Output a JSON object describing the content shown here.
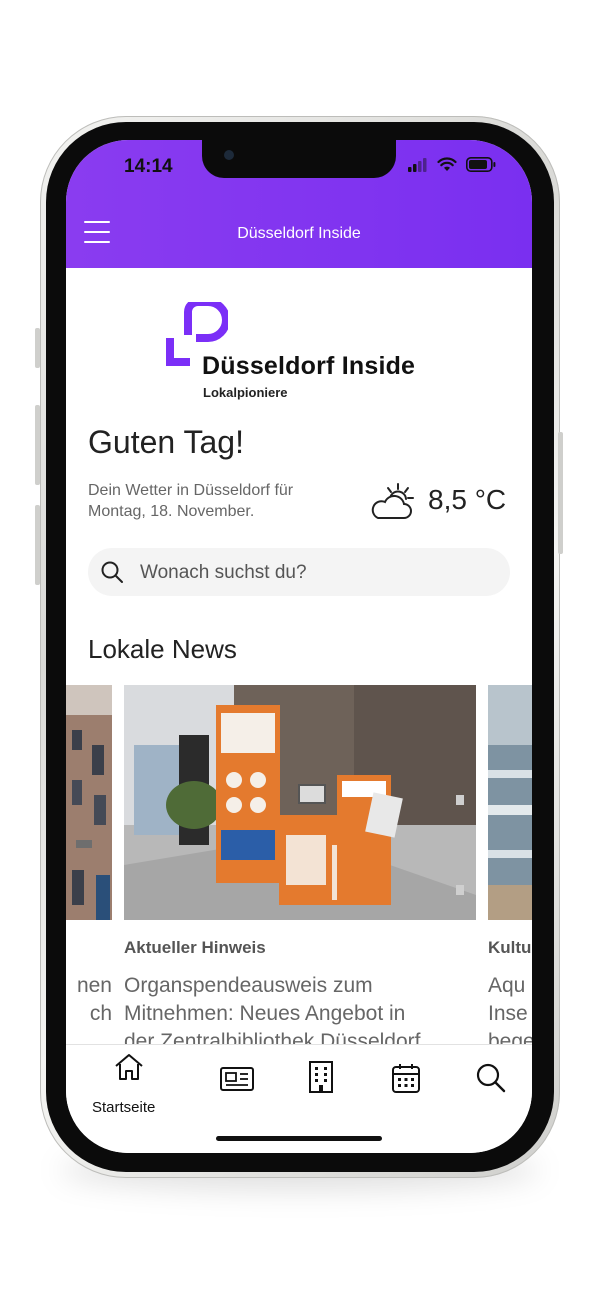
{
  "status_bar": {
    "time": "14:14"
  },
  "header": {
    "title": "Düsseldorf Inside",
    "menu_icon": "hamburger-menu-icon"
  },
  "brand": {
    "name": "Düsseldorf Inside",
    "tagline": "Lokalpioniere",
    "color": "#7b2ff7"
  },
  "greeting": "Guten Tag!",
  "weather": {
    "line1": "Dein Wetter in Düsseldorf für",
    "line2": "Montag, 18. November.",
    "temperature": "8,5 °C",
    "icon": "partly-cloudy-icon"
  },
  "search": {
    "placeholder": "Wonach suchst du?"
  },
  "news_section": {
    "title": "Lokale News",
    "cards": [
      {
        "category": "",
        "headline_line1": "nen",
        "headline_line2": "ch"
      },
      {
        "category": "Aktueller Hinweis",
        "headline_line1": "Organspendeausweis zum",
        "headline_line2": "Mitnehmen: Neues Angebot in",
        "headline_line3": "der Zentralbibliothek Düsseldorf"
      },
      {
        "category": "Kultu",
        "headline_line1": "Aqu",
        "headline_line2": "Inse",
        "headline_line3": "bege"
      }
    ]
  },
  "bottom_nav": [
    {
      "label": "Startseite",
      "icon": "home-icon"
    },
    {
      "label": "",
      "icon": "newspaper-icon"
    },
    {
      "label": "",
      "icon": "building-icon"
    },
    {
      "label": "",
      "icon": "calendar-icon"
    },
    {
      "label": "",
      "icon": "search-icon"
    }
  ]
}
